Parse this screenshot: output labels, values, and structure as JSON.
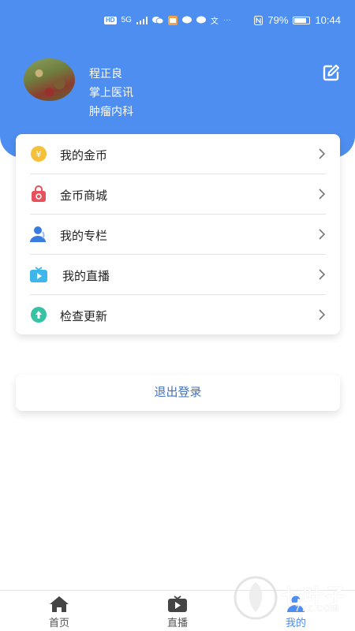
{
  "status_bar": {
    "network_chip": "HD",
    "signal_label": "5G",
    "battery_percent": "79%",
    "time": "10:44",
    "more": "···",
    "text_glyph": "文"
  },
  "profile": {
    "name": "程正良",
    "organization": "掌上医讯",
    "department": "肿瘤内科"
  },
  "menu": {
    "items": [
      {
        "label": "我的金币",
        "icon": "coin-icon"
      },
      {
        "label": "金币商城",
        "icon": "shopping-bag-icon"
      },
      {
        "label": "我的专栏",
        "icon": "user-column-icon"
      },
      {
        "label": "我的直播",
        "icon": "tv-icon"
      },
      {
        "label": "检查更新",
        "icon": "upload-icon"
      }
    ]
  },
  "logout": {
    "label": "退出登录"
  },
  "tabbar": {
    "tabs": [
      {
        "label": "首页",
        "icon": "home-icon"
      },
      {
        "label": "直播",
        "icon": "live-tv-icon"
      },
      {
        "label": "我的",
        "icon": "person-icon",
        "active": true
      }
    ]
  },
  "watermark": {
    "text": "七叶子",
    "sub": "7YZ.COM"
  },
  "colors": {
    "primary": "#4d8ef0",
    "logout_text": "#3f73c4"
  }
}
